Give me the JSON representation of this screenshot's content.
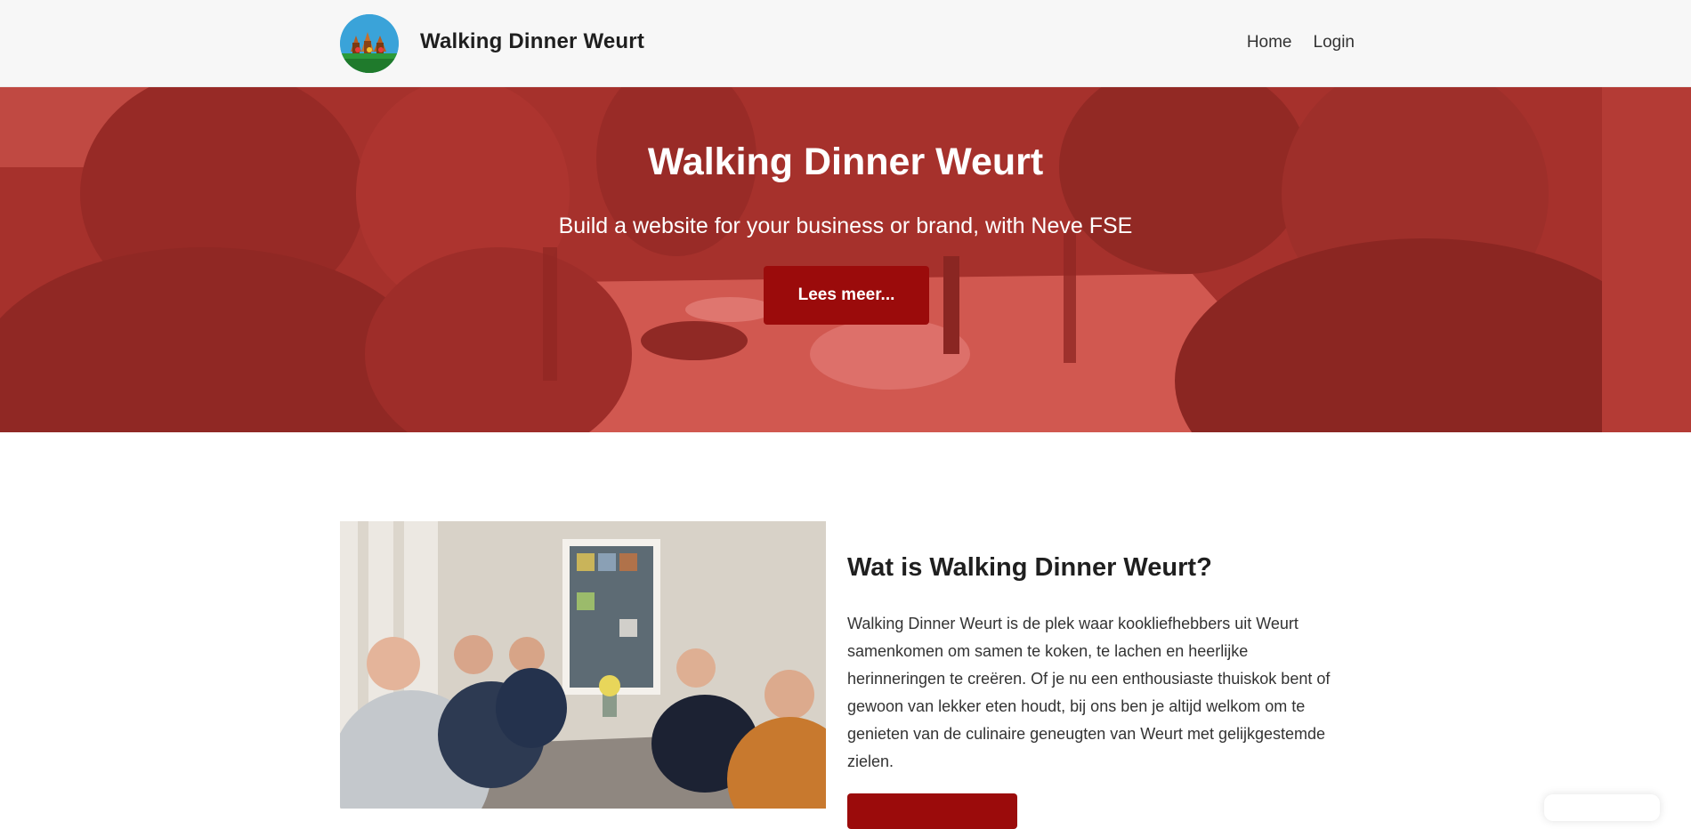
{
  "header": {
    "site_title": "Walking Dinner Weurt",
    "nav": [
      {
        "label": "Home"
      },
      {
        "label": "Login"
      }
    ]
  },
  "hero": {
    "title": "Walking Dinner Weurt",
    "subtitle": "Build a website for your business or brand, with Neve FSE",
    "button_label": "Lees meer..."
  },
  "about": {
    "title": "Wat is Walking Dinner Weurt?",
    "text": "Walking Dinner Weurt is de plek waar kookliefhebbers uit Weurt samenkomen om samen te koken, te lachen en heerlijke herinneringen te creëren. Of je nu een enthousiaste thuiskok bent of gewoon van lekker eten houdt, bij ons ben je altijd welkom om te genieten van de culinaire geneugten van Weurt met gelijkgestemde zielen.",
    "button_label": ""
  },
  "colors": {
    "accent": "#9b0b0b",
    "hero_overlay": "#d73c37",
    "header_bg": "#f7f7f7"
  },
  "icons": {
    "logo": "walking-dinner-logo"
  }
}
